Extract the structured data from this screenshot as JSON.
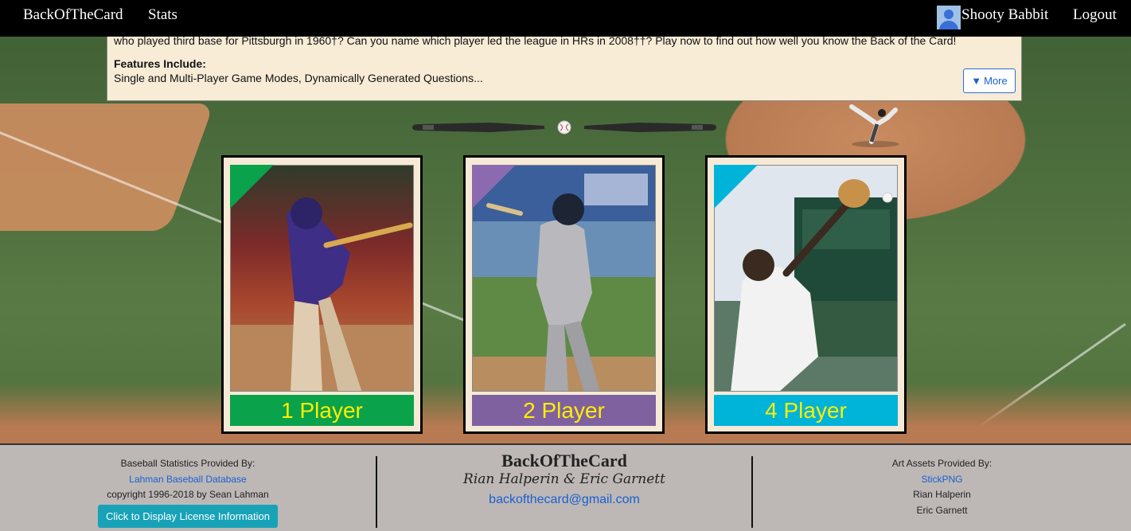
{
  "navbar": {
    "brand": "BackOfTheCard",
    "stats": "Stats",
    "username": "Shooty Babbit",
    "logout": "Logout"
  },
  "intro": {
    "text": "who played third base for Pittsburgh in 1960†? Can you name which player led the league in HRs in 2008††? Play now to find out how well you know the Back of the Card!",
    "features_title": "Features Include:",
    "features_text": "Single and Multi-Player Game Modes, Dynamically Generated Questions...",
    "more_label": "More",
    "more_icon": "triangle-down-icon"
  },
  "cards": [
    {
      "label": "1 Player",
      "color": "#0aa24a",
      "corner_color": "#0aa24a"
    },
    {
      "label": "2 Player",
      "color": "#7f61a0",
      "corner_color": "#8c6aaf"
    },
    {
      "label": "4 Player",
      "color": "#00b3d9",
      "corner_color": "#00b3d9"
    }
  ],
  "footer": {
    "left": {
      "heading": "Baseball Statistics Provided By:",
      "link": "Lahman Baseball Database",
      "copyright": "copyright 1996-2018 by Sean Lahman",
      "button": "Click to Display License Information"
    },
    "middle": {
      "brand": "BackOfTheCard",
      "authors": "Rian Halperin & Eric Garnett",
      "email": "backofthecard@gmail.com"
    },
    "right": {
      "heading": "Art Assets Provided By:",
      "link": "StickPNG",
      "name1": "Rian Halperin",
      "name2": "Eric Garnett"
    }
  }
}
